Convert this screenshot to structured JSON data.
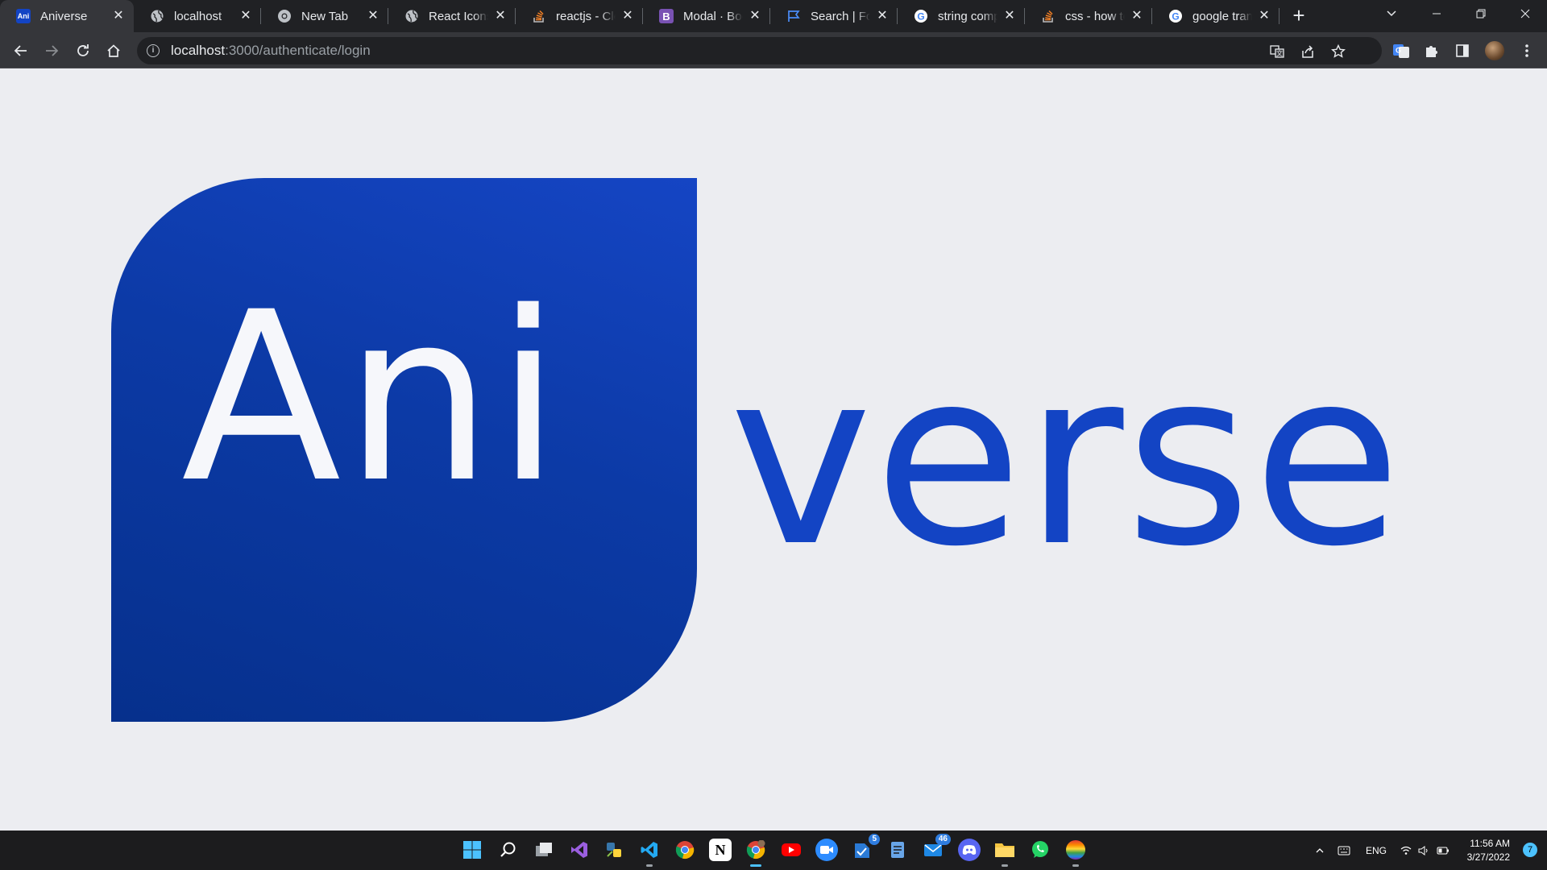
{
  "browser": {
    "tabs": [
      {
        "title": "Aniverse",
        "icon": "aniverse-favicon",
        "favicon_text": "Ani",
        "active": true
      },
      {
        "title": "localhost",
        "icon": "globe-icon"
      },
      {
        "title": "New Tab",
        "icon": "chrome-icon"
      },
      {
        "title": "React Icons",
        "icon": "globe-icon"
      },
      {
        "title": "reactjs - Clea",
        "icon": "stackoverflow-icon"
      },
      {
        "title": "Modal · Boot",
        "icon": "bootstrap-icon",
        "favicon_text": "B"
      },
      {
        "title": "Search | Font",
        "icon": "flag-icon"
      },
      {
        "title": "string compa",
        "icon": "google-icon"
      },
      {
        "title": "css - how to",
        "icon": "stackoverflow-icon"
      },
      {
        "title": "google trans",
        "icon": "google-icon"
      }
    ],
    "new_tab_label": "+",
    "address": {
      "host": "localhost",
      "path": ":3000/authenticate/login"
    }
  },
  "page": {
    "logo_left": "Ani",
    "logo_right": "verse",
    "colors": {
      "brand_blue": "#1344c4",
      "block_dark": "#06308c",
      "background": "#ecedf1"
    }
  },
  "taskbar": {
    "apps": [
      {
        "name": "start",
        "icon": "windows-start-icon"
      },
      {
        "name": "search",
        "icon": "search-icon"
      },
      {
        "name": "task-view",
        "icon": "task-view-icon"
      },
      {
        "name": "visual-studio",
        "icon": "visual-studio-icon"
      },
      {
        "name": "python",
        "icon": "python-idle-icon"
      },
      {
        "name": "vscode",
        "icon": "vscode-icon"
      },
      {
        "name": "chrome",
        "icon": "chrome-icon"
      },
      {
        "name": "notion",
        "icon": "notion-icon"
      },
      {
        "name": "chrome-profile",
        "icon": "chrome-icon"
      },
      {
        "name": "youtube",
        "icon": "youtube-icon"
      },
      {
        "name": "zoom",
        "icon": "zoom-icon"
      },
      {
        "name": "tasks",
        "icon": "tasks-icon",
        "badge": "5"
      },
      {
        "name": "notepad",
        "icon": "notepad-icon"
      },
      {
        "name": "mail",
        "icon": "mail-icon",
        "badge": "46"
      },
      {
        "name": "discord",
        "icon": "discord-icon"
      },
      {
        "name": "file-explorer",
        "icon": "folder-icon"
      },
      {
        "name": "whatsapp",
        "icon": "whatsapp-icon"
      },
      {
        "name": "pride-app",
        "icon": "rainbow-circle-icon"
      }
    ],
    "tray": {
      "language": "ENG",
      "time": "11:56 AM",
      "date": "3/27/2022",
      "notifications": "7"
    }
  }
}
